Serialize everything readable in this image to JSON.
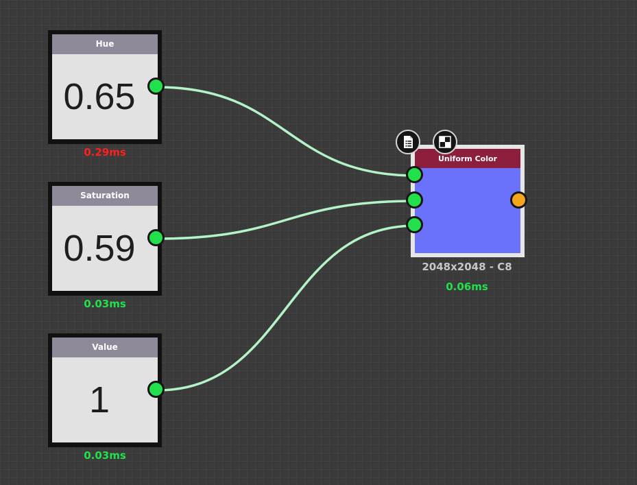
{
  "graph": {
    "nodes": [
      {
        "id": "hue",
        "title": "Hue",
        "value": "0.65",
        "timing": "0.29ms",
        "timing_color": "#ff1f1f"
      },
      {
        "id": "saturation",
        "title": "Saturation",
        "value": "0.59",
        "timing": "0.03ms",
        "timing_color": "#22e04c"
      },
      {
        "id": "value",
        "title": "Value",
        "value": "1",
        "timing": "0.03ms",
        "timing_color": "#22e04c"
      }
    ],
    "uniform_color": {
      "title": "Uniform Color",
      "resolution": "2048x2048 - C8",
      "timing": "0.06ms",
      "timing_color": "#22e04c",
      "preview_color": "#6a72fb",
      "header_color": "#8d1f3d",
      "icons": [
        "document-list-icon",
        "checker-pattern-icon"
      ]
    },
    "colors": {
      "wire": "#b4f2c8",
      "port_input": "#22e04c",
      "port_output": "#f3a51e",
      "canvas": "#3a3a3a"
    }
  }
}
